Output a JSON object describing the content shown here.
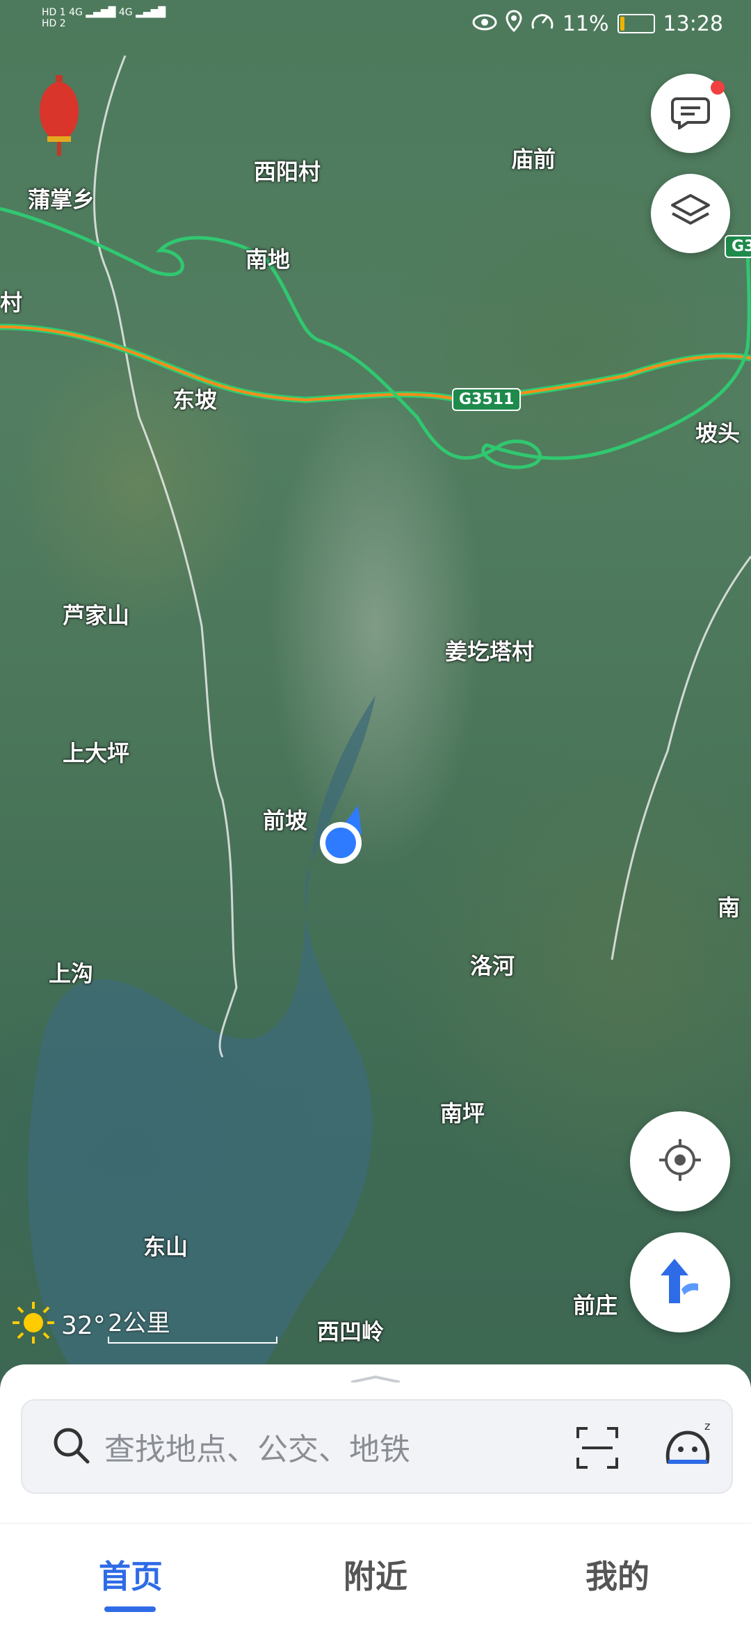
{
  "status_bar": {
    "left_icons": [
      "HD 1",
      "HD 2",
      "4G",
      "4G"
    ],
    "battery_percent": "11%",
    "time": "13:28",
    "icons": [
      "eye-icon",
      "location-icon",
      "speed-icon",
      "battery-icon"
    ]
  },
  "map": {
    "labels": [
      {
        "id": "puzhangxiang",
        "text": "蒲掌乡"
      },
      {
        "id": "xiyangcun",
        "text": "西阳村"
      },
      {
        "id": "miaoqian",
        "text": "庙前"
      },
      {
        "id": "nandi",
        "text": "南地"
      },
      {
        "id": "cun-left",
        "text": "村"
      },
      {
        "id": "dongpo",
        "text": "东坡"
      },
      {
        "id": "potou",
        "text": "坡头"
      },
      {
        "id": "lujiashan",
        "text": "芦家山"
      },
      {
        "id": "jianggetacun",
        "text": "姜圪塔村"
      },
      {
        "id": "shangdaping",
        "text": "上大坪"
      },
      {
        "id": "qianpo",
        "text": "前坡"
      },
      {
        "id": "nan-right",
        "text": "南"
      },
      {
        "id": "shanggou",
        "text": "上沟"
      },
      {
        "id": "luohe",
        "text": "洛河"
      },
      {
        "id": "nanping",
        "text": "南坪"
      },
      {
        "id": "dongshan",
        "text": "东山"
      },
      {
        "id": "qianzhuang",
        "text": "前庄"
      },
      {
        "id": "xiaoling",
        "text": "西凹岭"
      }
    ],
    "road_shields": [
      "G3511",
      "G3"
    ],
    "weather": {
      "temp": "32°",
      "icon": "sun-icon"
    },
    "scale": "2公里"
  },
  "buttons": {
    "message": {
      "icon": "message-icon",
      "has_badge": true
    },
    "layers": {
      "icon": "layers-icon"
    },
    "locate": {
      "icon": "locate-icon"
    },
    "route": {
      "icon": "route-arrow-icon"
    }
  },
  "search": {
    "placeholder": "查找地点、公交、地铁",
    "icons": [
      "search-icon",
      "scan-icon",
      "assistant-icon"
    ]
  },
  "tabs": [
    {
      "label": "首页",
      "active": true
    },
    {
      "label": "附近",
      "active": false
    },
    {
      "label": "我的",
      "active": false
    }
  ],
  "colors": {
    "accent": "#2e6be6",
    "road_green": "#2ecc71",
    "road_orange": "#ff8c1a",
    "badge_red": "#f04040"
  }
}
